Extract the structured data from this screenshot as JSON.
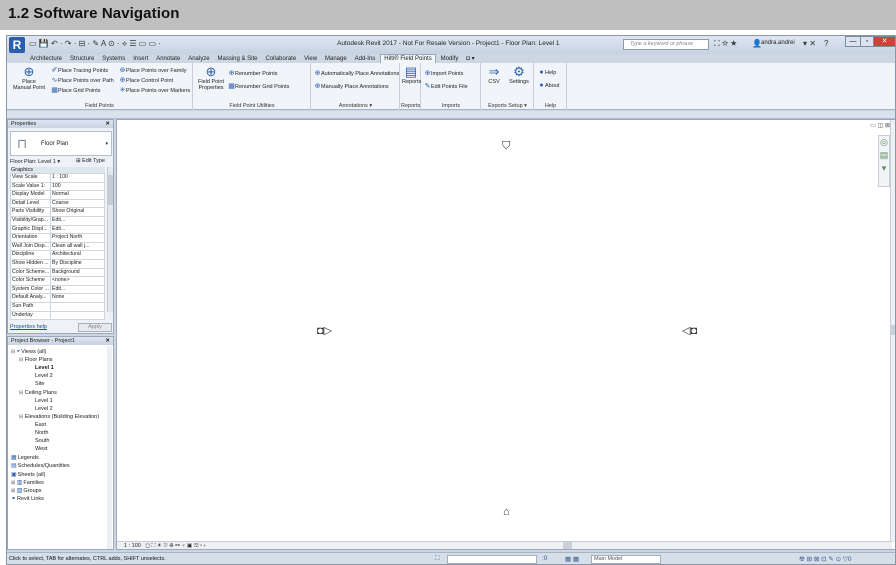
{
  "doc_header": {
    "title": "1.2  Software Navigation"
  },
  "window": {
    "app_title": "Autodesk Revit 2017 - Not For Resale Version -    Project1 - Floor Plan: Level 1",
    "search_placeholder": "Type a keyword or phrase",
    "user": "andra.andrei",
    "logo_letter": "R",
    "help_glyph": "?"
  },
  "ribbon_tabs": [
    "Architecture",
    "Structure",
    "Systems",
    "Insert",
    "Annotate",
    "Analyze",
    "Massing & Site",
    "Collaborate",
    "View",
    "Manage",
    "Add-Ins",
    "Hilti® Field Points",
    "Modify",
    "◘ ▾"
  ],
  "ribbon": {
    "field_points": {
      "title": "Field Points",
      "place_manual_point": "Place\nManual Point",
      "place_tracing_points": "Place Tracing Points",
      "place_points_over_path": "Place Points over Path",
      "place_grid_points": "Place Grid Points",
      "place_points_over_family": "Place Points over Family",
      "place_control_point": "Place Control Point",
      "place_points_over_markers": "Place Points over Markers"
    },
    "field_point_utilities": {
      "title": "Field Point Utilities",
      "field_point_properties": "Field Point\nProperties",
      "renumber_points": "Renumber Points",
      "renumber_grid_points": "Renumber Grid Points"
    },
    "annotations": {
      "title": "Annotations ▾",
      "automatically_place": "Automatically Place  Annotations",
      "manually_place": "Manually Place Annotations"
    },
    "reports": {
      "title": "Reports",
      "reports": "Reports"
    },
    "imports": {
      "title": "Imports",
      "import_points": "Import Points",
      "edit_points_file": "Edit Points File"
    },
    "exports_setup": {
      "exports": "Exports",
      "setup": "Setup ▾",
      "csv": "CSV",
      "settings": "Settings"
    },
    "help": {
      "title": "Help",
      "help": "Help",
      "about": "About"
    }
  },
  "properties": {
    "header": "Properties",
    "close": "✕",
    "type_name": "Floor Plan",
    "instance": "Floor Plan: Level 1",
    "edit_type": "Edit Type",
    "category": "Graphics",
    "rows": [
      [
        "View Scale",
        "1 : 100"
      ],
      [
        "Scale Value   1:",
        "100"
      ],
      [
        "Display Model",
        "Normal"
      ],
      [
        "Detail Level",
        "Coarse"
      ],
      [
        "Parts Visibility",
        "Show Original"
      ],
      [
        "Visibility/Grap...",
        "Edit..."
      ],
      [
        "Graphic Displ...",
        "Edit..."
      ],
      [
        "Orientation",
        "Project North"
      ],
      [
        "Wall Join Disp...",
        "Clean all wall j..."
      ],
      [
        "Discipline",
        "Architectural"
      ],
      [
        "Show Hidden ...",
        "By Discipline"
      ],
      [
        "Color Scheme...",
        "Background"
      ],
      [
        "Color Scheme",
        "<none>"
      ],
      [
        "System Color ...",
        "Edit..."
      ],
      [
        "Default Analy...",
        "None"
      ],
      [
        "Sun Path",
        ""
      ],
      [
        "Underlay",
        ""
      ]
    ],
    "help_link": "Properties help",
    "apply": "Apply"
  },
  "project_browser": {
    "header": "Project Browser - Project1",
    "close": "✕",
    "items": [
      {
        "text": "Views (all)",
        "depth": 0,
        "twisty": "⊟",
        "icon": "⌖",
        "bold": false
      },
      {
        "text": "Floor Plans",
        "depth": 1,
        "twisty": "⊟",
        "icon": "",
        "bold": false
      },
      {
        "text": "Level 1",
        "depth": 3,
        "twisty": "",
        "icon": "",
        "bold": true
      },
      {
        "text": "Level 2",
        "depth": 3,
        "twisty": "",
        "icon": "",
        "bold": false
      },
      {
        "text": "Site",
        "depth": 3,
        "twisty": "",
        "icon": "",
        "bold": false
      },
      {
        "text": "Ceiling Plans",
        "depth": 1,
        "twisty": "⊟",
        "icon": "",
        "bold": false
      },
      {
        "text": "Level 1",
        "depth": 3,
        "twisty": "",
        "icon": "",
        "bold": false
      },
      {
        "text": "Level 2",
        "depth": 3,
        "twisty": "",
        "icon": "",
        "bold": false
      },
      {
        "text": "Elevations (Building Elevation)",
        "depth": 1,
        "twisty": "⊟",
        "icon": "",
        "bold": false
      },
      {
        "text": "East",
        "depth": 3,
        "twisty": "",
        "icon": "",
        "bold": false
      },
      {
        "text": "North",
        "depth": 3,
        "twisty": "",
        "icon": "",
        "bold": false
      },
      {
        "text": "South",
        "depth": 3,
        "twisty": "",
        "icon": "",
        "bold": false
      },
      {
        "text": "West",
        "depth": 3,
        "twisty": "",
        "icon": "",
        "bold": false
      },
      {
        "text": "Legends",
        "depth": 0,
        "twisty": "",
        "icon": "▦",
        "bold": false
      },
      {
        "text": "Schedules/Quantities",
        "depth": 0,
        "twisty": "",
        "icon": "▤",
        "bold": false
      },
      {
        "text": "Sheets (all)",
        "depth": 0,
        "twisty": "",
        "icon": "▣",
        "bold": false
      },
      {
        "text": "Families",
        "depth": 0,
        "twisty": "⊞",
        "icon": "▥",
        "bold": false
      },
      {
        "text": "Groups",
        "depth": 0,
        "twisty": "⊞",
        "icon": "▧",
        "bold": false
      },
      {
        "text": "Revit Links",
        "depth": 0,
        "twisty": "",
        "icon": "⚭",
        "bold": false
      }
    ]
  },
  "canvas": {
    "elevation_markers": {
      "north": "⛉",
      "west": "◘▷",
      "east": "◁◘",
      "south": "⌂"
    },
    "view_cube": "▭ ◫ ⊠",
    "nav_bar": [
      "◎",
      "▤",
      "▾"
    ]
  },
  "view_control": {
    "scale": "1 : 100",
    "icons": "◻ ⛶ ☀ ⛆ ⛯ ⚯ ♀ ▣ ⛫ ▫ ›"
  },
  "status": {
    "text": "Click to select, TAB for alternates, CTRL adds, SHIFT unselects.",
    "coord": ":0",
    "model": "Main Model",
    "right_icons": "☢ ⊞ ⊠ ⊡ ✎ ⊙ ▽0"
  }
}
